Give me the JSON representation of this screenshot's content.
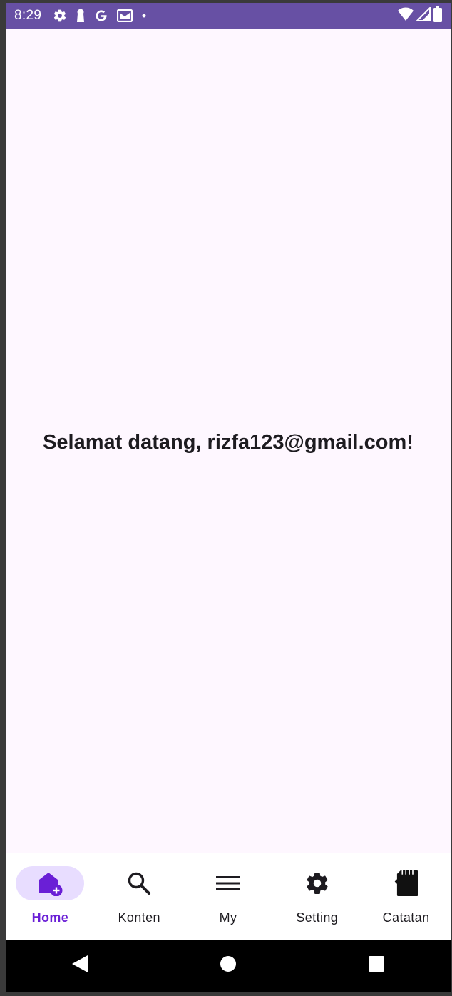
{
  "status_bar": {
    "time": "8:29",
    "left_icons": [
      "settings-icon",
      "keyhole-icon",
      "google-icon",
      "gmail-icon",
      "dot-icon"
    ],
    "right_icons": [
      "wifi-icon",
      "signal-icon",
      "battery-icon"
    ],
    "background": "#6750a4"
  },
  "main": {
    "welcome_text": "Selamat datang, rizfa123@gmail.com!"
  },
  "bottom_nav": {
    "active_color": "#6a1fd6",
    "indicator_color": "#e8ddff",
    "items": [
      {
        "label": "Home",
        "icon": "home-add-icon",
        "active": true
      },
      {
        "label": "Konten",
        "icon": "search-icon",
        "active": false
      },
      {
        "label": "My",
        "icon": "menu-icon",
        "active": false
      },
      {
        "label": "Setting",
        "icon": "gear-icon",
        "active": false
      },
      {
        "label": "Catatan",
        "icon": "sd-card-icon",
        "active": false
      }
    ]
  },
  "system_nav": {
    "buttons": [
      "back-icon",
      "home-circle-icon",
      "recents-icon"
    ]
  }
}
